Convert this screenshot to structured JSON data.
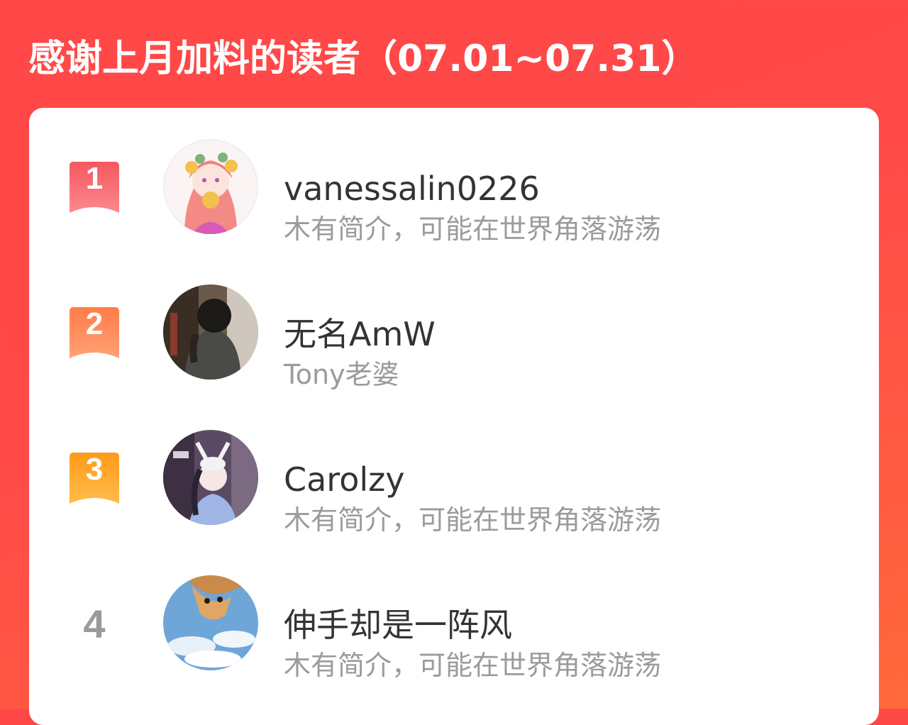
{
  "header": {
    "title": "感谢上月加料的读者（07.01~07.31）"
  },
  "colors": {
    "background_top": "#ff4747",
    "background_bottom": "#ff6a3a",
    "rank1": "#f7626a",
    "rank2": "#ff8a5a",
    "rank3": "#ffa326",
    "rank_plain": "#9a9a9a",
    "name_text": "#333333",
    "bio_text": "#9b9b9b"
  },
  "readers": [
    {
      "rank": "1",
      "name": "vanessalin0226",
      "bio": "木有简介，可能在世界角落游荡",
      "avatar_icon": "anime-girl-avatar"
    },
    {
      "rank": "2",
      "name": "无名AmW",
      "bio": "Tony老婆",
      "avatar_icon": "girl-photo-avatar"
    },
    {
      "rank": "3",
      "name": "Carolzy",
      "bio": "木有简介，可能在世界角落游荡",
      "avatar_icon": "anime-maid-avatar"
    },
    {
      "rank": "4",
      "name": "伸手却是一阵风",
      "bio": "木有简介，可能在世界角落游荡",
      "avatar_icon": "cat-sky-avatar"
    }
  ]
}
